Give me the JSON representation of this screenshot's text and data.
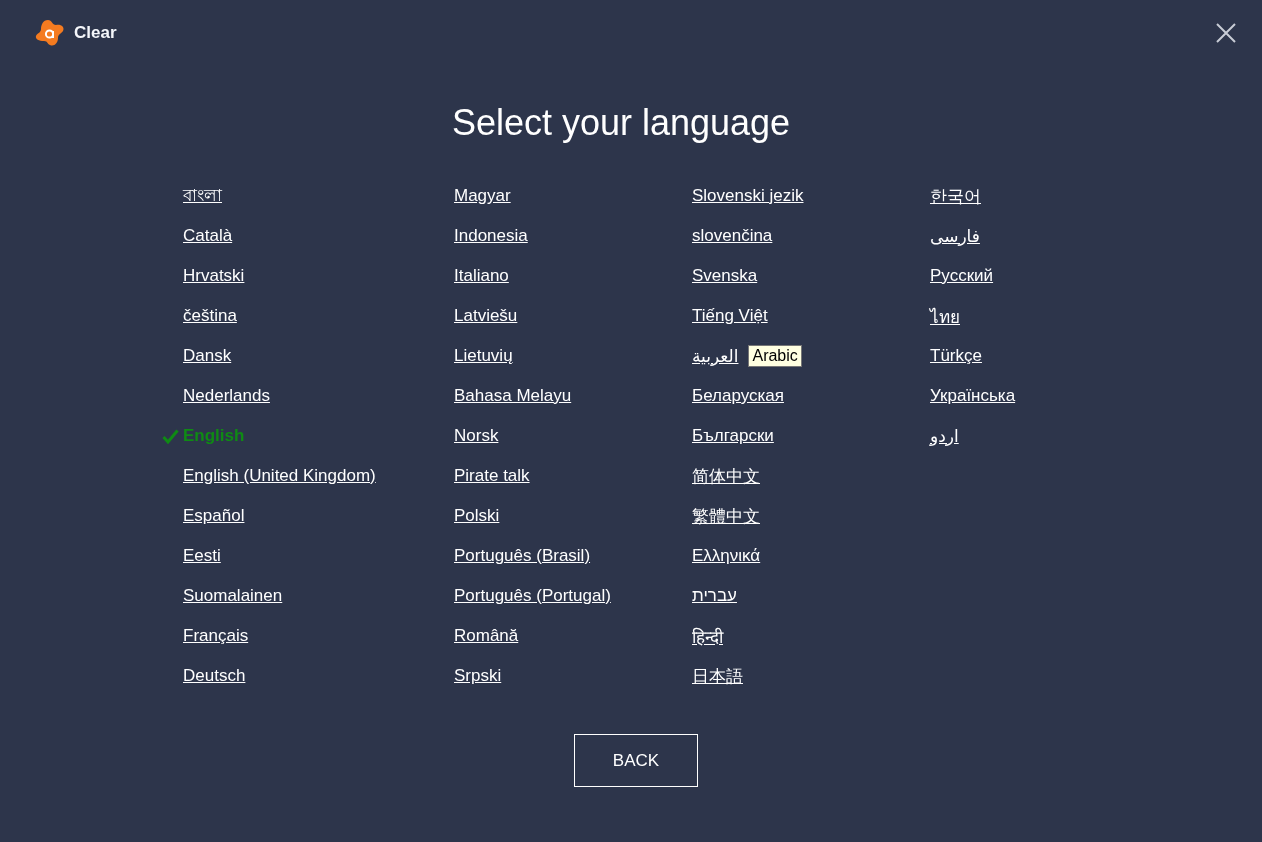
{
  "app": {
    "name": "Clear"
  },
  "title": "Select your language",
  "columns": [
    [
      {
        "label": "বাংলা",
        "selected": false
      },
      {
        "label": "Català",
        "selected": false
      },
      {
        "label": "Hrvatski",
        "selected": false
      },
      {
        "label": "čeština",
        "selected": false
      },
      {
        "label": "Dansk",
        "selected": false
      },
      {
        "label": "Nederlands",
        "selected": false
      },
      {
        "label": "English",
        "selected": true
      },
      {
        "label": "English (United Kingdom)",
        "selected": false
      },
      {
        "label": "Español",
        "selected": false
      },
      {
        "label": "Eesti",
        "selected": false
      },
      {
        "label": "Suomalainen",
        "selected": false
      },
      {
        "label": "Français",
        "selected": false
      },
      {
        "label": "Deutsch",
        "selected": false
      }
    ],
    [
      {
        "label": "Magyar",
        "selected": false
      },
      {
        "label": "Indonesia",
        "selected": false
      },
      {
        "label": "Italiano",
        "selected": false
      },
      {
        "label": "Latviešu",
        "selected": false
      },
      {
        "label": "Lietuvių",
        "selected": false
      },
      {
        "label": "Bahasa Melayu",
        "selected": false
      },
      {
        "label": "Norsk",
        "selected": false
      },
      {
        "label": "Pirate talk",
        "selected": false
      },
      {
        "label": "Polski",
        "selected": false
      },
      {
        "label": "Português (Brasil)",
        "selected": false
      },
      {
        "label": "Português (Portugal)",
        "selected": false
      },
      {
        "label": "Română",
        "selected": false
      },
      {
        "label": "Srpski",
        "selected": false
      }
    ],
    [
      {
        "label": "Slovenski jezik",
        "selected": false
      },
      {
        "label": "slovenčina",
        "selected": false
      },
      {
        "label": "Svenska",
        "selected": false
      },
      {
        "label": "Tiếng Việt",
        "selected": false
      },
      {
        "label": "العربية",
        "selected": false,
        "tooltip": "Arabic"
      },
      {
        "label": "Беларуская",
        "selected": false
      },
      {
        "label": "Български",
        "selected": false
      },
      {
        "label": "简体中文",
        "selected": false
      },
      {
        "label": "繁體中文",
        "selected": false
      },
      {
        "label": "Ελληνικά",
        "selected": false
      },
      {
        "label": "עברית",
        "selected": false
      },
      {
        "label": "हिन्दी",
        "selected": false
      },
      {
        "label": "日本語",
        "selected": false
      }
    ],
    [
      {
        "label": "한국어",
        "selected": false
      },
      {
        "label": "فارسی",
        "selected": false
      },
      {
        "label": "Русский",
        "selected": false
      },
      {
        "label": "ไทย",
        "selected": false
      },
      {
        "label": "Türkçe",
        "selected": false
      },
      {
        "label": "Українська",
        "selected": false
      },
      {
        "label": "اردو",
        "selected": false
      }
    ]
  ],
  "back_button": "BACK"
}
